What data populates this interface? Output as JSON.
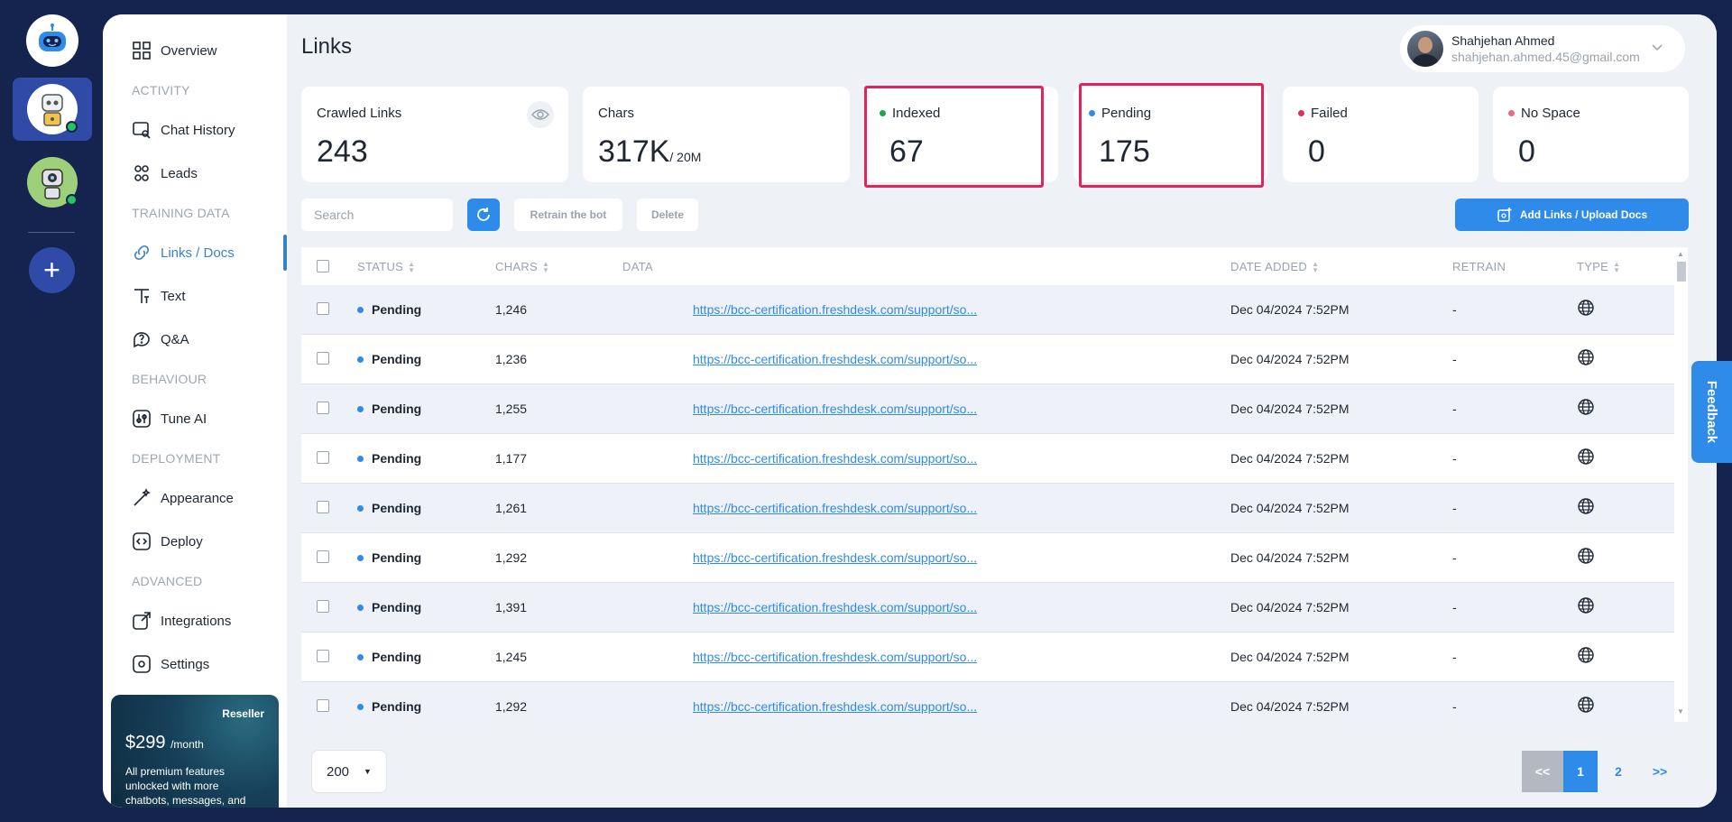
{
  "sidebar": {
    "overview": "Overview",
    "sections": {
      "activity": "ACTIVITY",
      "training": "TRAINING DATA",
      "behaviour": "BEHAVIOUR",
      "deployment": "DEPLOYMENT",
      "advanced": "ADVANCED"
    },
    "items": {
      "chat_history": "Chat History",
      "leads": "Leads",
      "links_docs": "Links / Docs",
      "text": "Text",
      "qa": "Q&A",
      "tune_ai": "Tune AI",
      "appearance": "Appearance",
      "deploy": "Deploy",
      "integrations": "Integrations",
      "settings": "Settings"
    },
    "promo": {
      "tier": "Reseller",
      "price": "$299",
      "period": "/month",
      "desc": "All premium features unlocked with more chatbots, messages, and"
    }
  },
  "header": {
    "title": "Links",
    "user_name": "Shahjehan Ahmed",
    "user_email": "shahjehan.ahmed.45@gmail.com"
  },
  "stats": {
    "crawled": {
      "label": "Crawled Links",
      "value": "243"
    },
    "chars": {
      "label": "Chars",
      "value": "317K",
      "suffix": "/ 20M"
    },
    "indexed": {
      "label": "Indexed",
      "value": "67",
      "color": "#22a34a"
    },
    "pending": {
      "label": "Pending",
      "value": "175",
      "color": "#2e8bea"
    },
    "failed": {
      "label": "Failed",
      "value": "0",
      "color": "#d63363"
    },
    "nospace": {
      "label": "No Space",
      "value": "0",
      "color": "#e86a86"
    }
  },
  "toolbar": {
    "search_placeholder": "Search",
    "retrain": "Retrain the bot",
    "delete": "Delete",
    "add": "Add Links / Upload Docs"
  },
  "table": {
    "headers": {
      "status": "STATUS",
      "chars": "CHARS",
      "data": "DATA",
      "date": "DATE ADDED",
      "retrain": "RETRAIN",
      "type": "TYPE"
    },
    "rows": [
      {
        "status": "Pending",
        "chars": "1,246",
        "url": "https://bcc-certification.freshdesk.com/support/so...",
        "date": "Dec 04/2024 7:52PM",
        "retrain": "-"
      },
      {
        "status": "Pending",
        "chars": "1,236",
        "url": "https://bcc-certification.freshdesk.com/support/so...",
        "date": "Dec 04/2024 7:52PM",
        "retrain": "-"
      },
      {
        "status": "Pending",
        "chars": "1,255",
        "url": "https://bcc-certification.freshdesk.com/support/so...",
        "date": "Dec 04/2024 7:52PM",
        "retrain": "-"
      },
      {
        "status": "Pending",
        "chars": "1,177",
        "url": "https://bcc-certification.freshdesk.com/support/so...",
        "date": "Dec 04/2024 7:52PM",
        "retrain": "-"
      },
      {
        "status": "Pending",
        "chars": "1,261",
        "url": "https://bcc-certification.freshdesk.com/support/so...",
        "date": "Dec 04/2024 7:52PM",
        "retrain": "-"
      },
      {
        "status": "Pending",
        "chars": "1,292",
        "url": "https://bcc-certification.freshdesk.com/support/so...",
        "date": "Dec 04/2024 7:52PM",
        "retrain": "-"
      },
      {
        "status": "Pending",
        "chars": "1,391",
        "url": "https://bcc-certification.freshdesk.com/support/so...",
        "date": "Dec 04/2024 7:52PM",
        "retrain": "-"
      },
      {
        "status": "Pending",
        "chars": "1,245",
        "url": "https://bcc-certification.freshdesk.com/support/so...",
        "date": "Dec 04/2024 7:52PM",
        "retrain": "-"
      },
      {
        "status": "Pending",
        "chars": "1,292",
        "url": "https://bcc-certification.freshdesk.com/support/so...",
        "date": "Dec 04/2024 7:52PM",
        "retrain": "-"
      }
    ]
  },
  "footer": {
    "page_size": "200",
    "first": "<<",
    "page1": "1",
    "page2": "2",
    "next": ">>"
  },
  "feedback": "Feedback"
}
